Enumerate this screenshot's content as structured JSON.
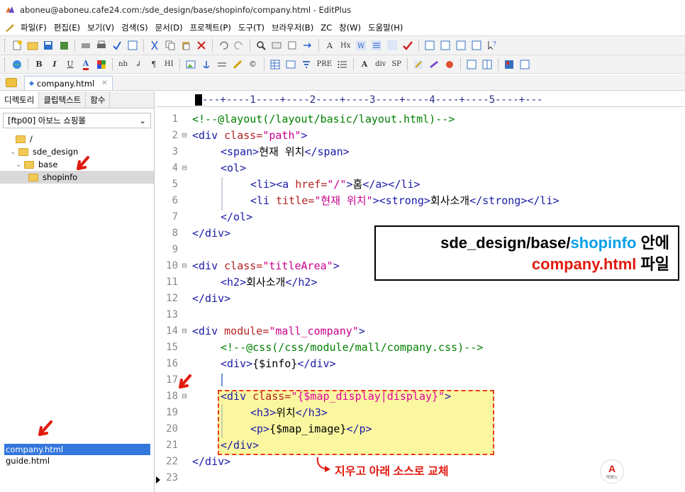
{
  "window": {
    "title": "aboneu@aboneu.cafe24.com:/sde_design/base/shopinfo/company.html - EditPlus"
  },
  "menu": [
    "파일(F)",
    "편집(E)",
    "보기(V)",
    "검색(S)",
    "문서(D)",
    "프로젝트(P)",
    "도구(T)",
    "브라우저(B)",
    "ZC",
    "창(W)",
    "도움말(H)"
  ],
  "doc_tab": {
    "label": "company.html"
  },
  "sidebar": {
    "tabs": [
      "디렉토리",
      "클립텍스트",
      "함수"
    ],
    "ftp": "[ftp00] 아보느 쇼핑몰",
    "tree": [
      "/",
      "sde_design",
      "base",
      "shopinfo"
    ],
    "files": [
      "company.html",
      "guide.html"
    ]
  },
  "ruler": "---+----1----+----2----+----3----+----4----+----5----+---",
  "code": {
    "l1": "<!--@layout(/layout/basic/layout.html)-->",
    "l3_open": "<span>",
    "l3_text": "현재 위치",
    "l3_close": "</span>",
    "l5_a": "<li><a ",
    "l5_attr": "href=",
    "l5_val": "\"/\"",
    "l5_b": ">",
    "l5_text": "홈",
    "l5_c": "</a></li>",
    "l6_a": "<li ",
    "l6_attr": "title=",
    "l6_val": "\"현재 위치\"",
    "l6_b": "><strong>",
    "l6_text": "회사소개",
    "l6_c": "</strong></li>",
    "l11_a": "<h2>",
    "l11_text": "회사소개",
    "l11_b": "</h2>",
    "l15": "<!--@css(/css/module/mall/company.css)-->",
    "l16_a": "<div>",
    "l16_text": "{$info}",
    "l16_b": "</div>",
    "l18_val": "\"{$map_display|display}\"",
    "l19_a": "<h3>",
    "l19_text": "위치",
    "l19_b": "</h3>",
    "l20_a": "<p>",
    "l20_text": "{$map_image}",
    "l20_b": "</p>"
  },
  "annotation": {
    "line1_path": "sde_design/base/",
    "line1_hl": "shopinfo",
    "line1_suffix": " 안에",
    "line2_hl": "company.html",
    "line2_suffix": " 파일"
  },
  "note": "지우고 아래 소스로 교체",
  "logo": {
    "mark": "A",
    "sub": "아보느"
  },
  "colors": {
    "accent_red": "#e01b0f",
    "accent_blue": "#0aa0e8",
    "highlight": "#fbf7a0"
  }
}
